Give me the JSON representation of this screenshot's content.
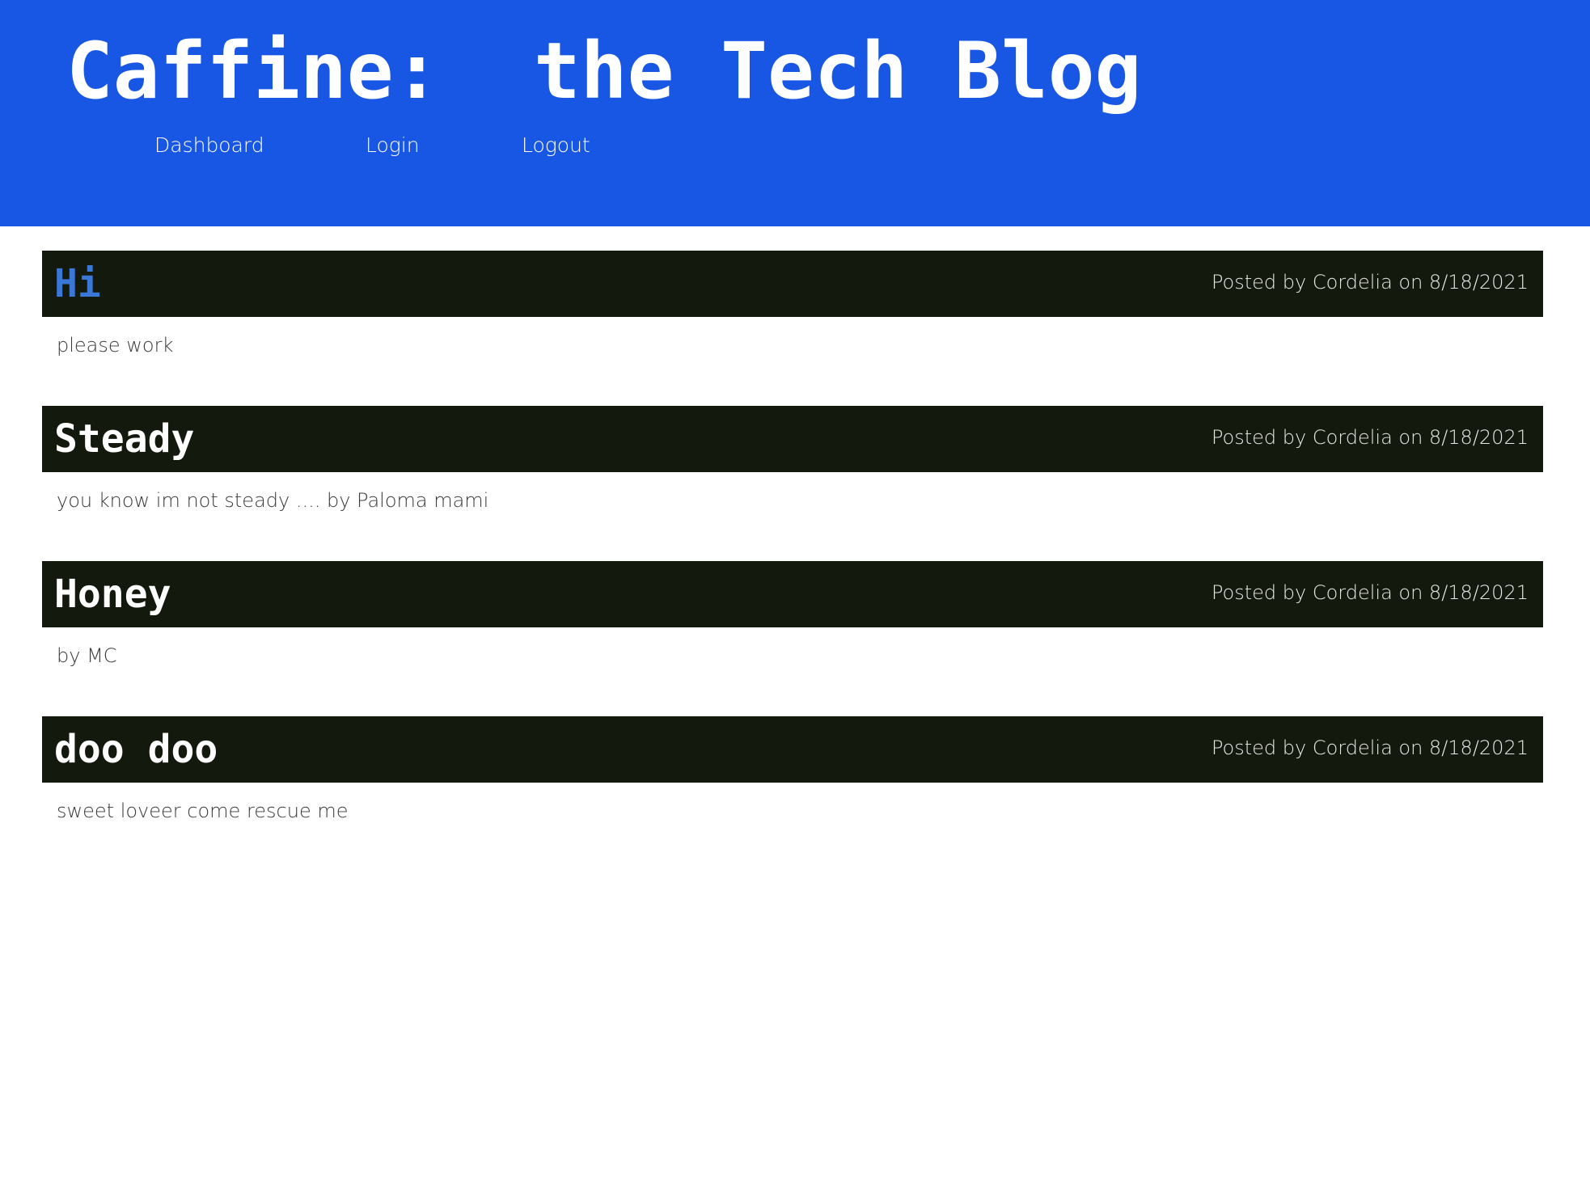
{
  "site": {
    "title": "Caffine:  the Tech Blog",
    "header_color": "#1856e4"
  },
  "nav": {
    "items": [
      {
        "label": "Dashboard"
      },
      {
        "label": "Login"
      },
      {
        "label": "Logout"
      }
    ]
  },
  "posts": [
    {
      "title": "Hi",
      "meta": "Posted by Cordelia on 8/18/2021",
      "body": "please work",
      "title_color": "#3a78d8"
    },
    {
      "title": "Steady",
      "meta": "Posted by Cordelia on 8/18/2021",
      "body": "you know im not steady .... by Paloma mami"
    },
    {
      "title": "Honey",
      "meta": "Posted by Cordelia on 8/18/2021",
      "body": "by MC"
    },
    {
      "title": "doo doo",
      "meta": "Posted by Cordelia on 8/18/2021",
      "body": "sweet loveer come rescue me"
    }
  ],
  "colors": {
    "post_header_bg": "#14190d",
    "page_bg": "#ffffff"
  }
}
